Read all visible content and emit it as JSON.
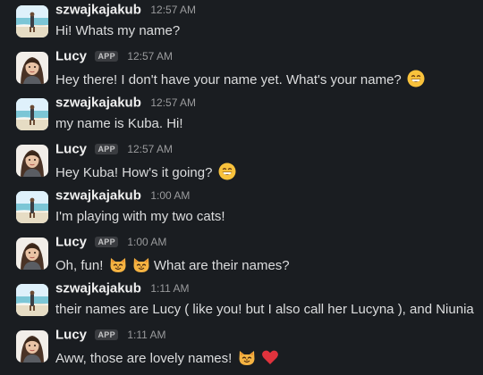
{
  "messages": [
    {
      "author": "szwajkajakub",
      "badge": "",
      "time": "12:57 AM",
      "text": "Hi! Whats my name?",
      "emojis": []
    },
    {
      "author": "Lucy",
      "badge": "APP",
      "time": "12:57 AM",
      "text": "Hey there! I don't have your name yet. What's your name?",
      "emojis": [
        "grinning-face"
      ]
    },
    {
      "author": "szwajkajakub",
      "badge": "",
      "time": "12:57 AM",
      "text": "my name is Kuba. Hi!",
      "emojis": []
    },
    {
      "author": "Lucy",
      "badge": "APP",
      "time": "12:57 AM",
      "text": "Hey Kuba! How's it going?",
      "emojis": [
        "grinning-face"
      ]
    },
    {
      "author": "szwajkajakub",
      "badge": "",
      "time": "1:00 AM",
      "text": "I'm playing with my two cats!",
      "emojis": []
    },
    {
      "author": "Lucy",
      "badge": "APP",
      "time": "1:00 AM",
      "text_before": "Oh, fun!",
      "text_after": "What are their names?",
      "emojis": [
        "cat-face",
        "cat-face"
      ]
    },
    {
      "author": "szwajkajakub",
      "badge": "",
      "time": "1:11 AM",
      "text": "their names are Lucy ( like you! but I also call her Lucyna ), and Niunia",
      "emojis": []
    },
    {
      "author": "Lucy",
      "badge": "APP",
      "time": "1:11 AM",
      "text": "Aww, those are lovely names!",
      "emojis": [
        "cat-face",
        "red-heart"
      ]
    }
  ],
  "colors": {
    "background": "#1a1d21",
    "name": "#f0f0f0",
    "timestamp": "#9a9b9d",
    "message_text": "#dcddde",
    "badge_bg": "#3a3c40"
  }
}
